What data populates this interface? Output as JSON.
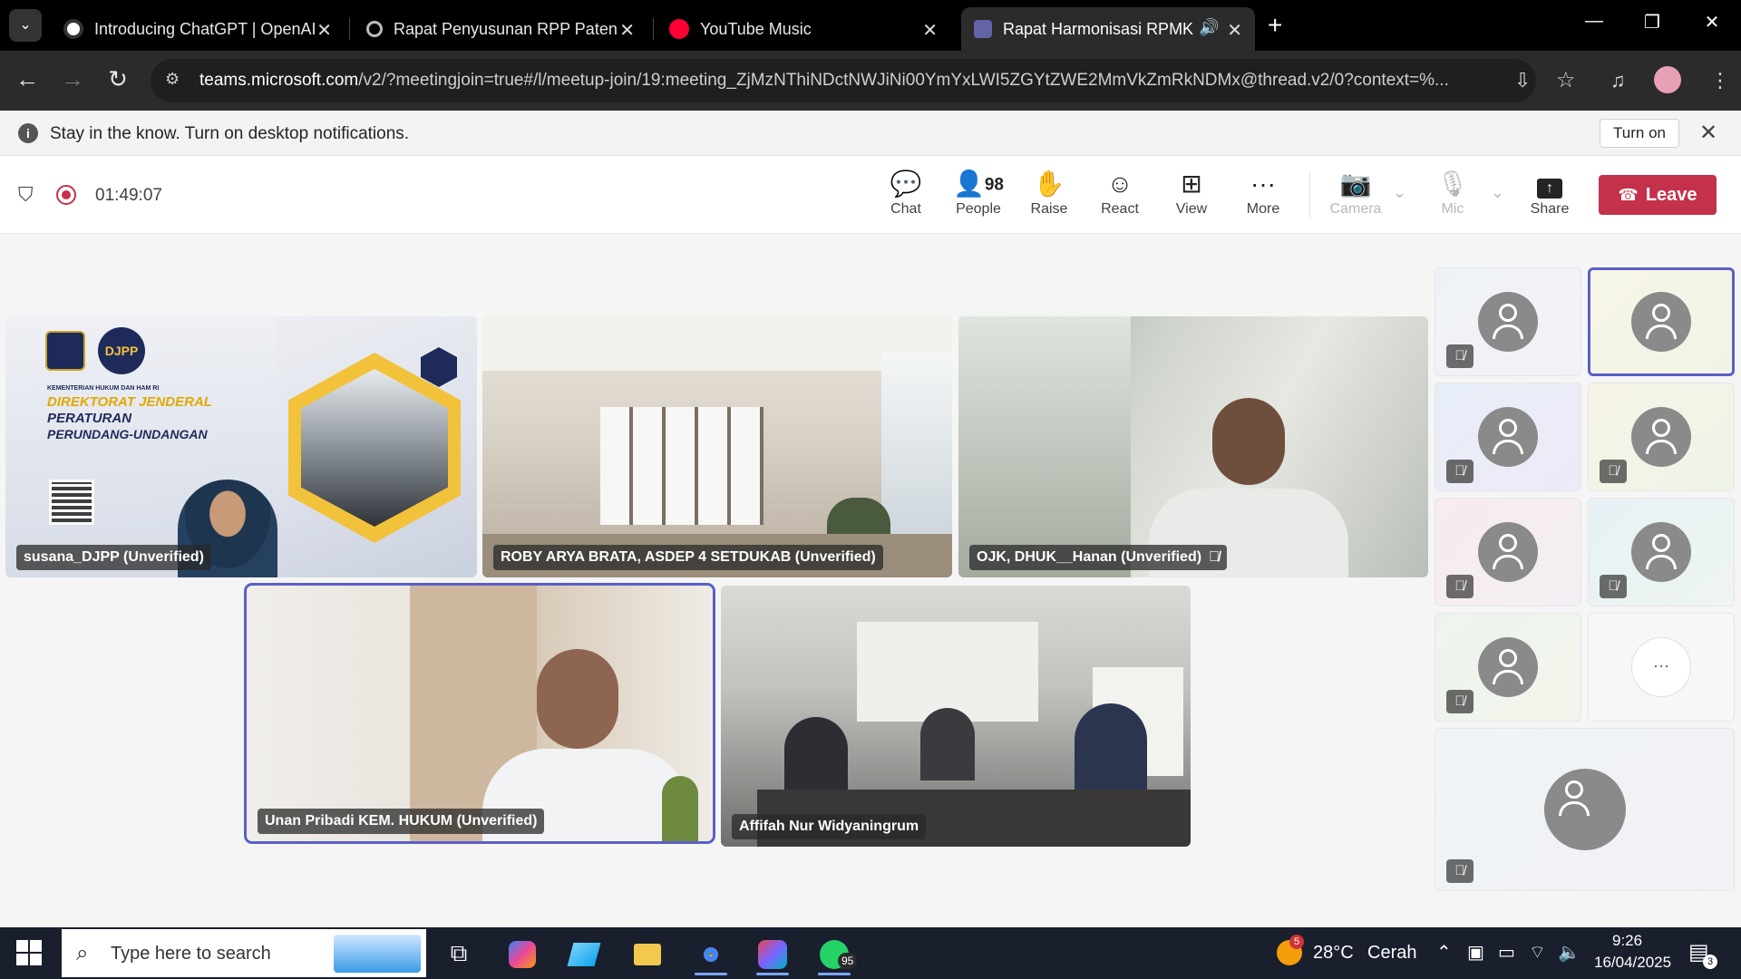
{
  "browser": {
    "tabs": [
      {
        "label": "Introducing ChatGPT | OpenAI",
        "icon": "openai-icon"
      },
      {
        "label": "Rapat Penyusunan RPP Paten",
        "icon": "openai-icon"
      },
      {
        "label": "YouTube Music",
        "icon": "youtube-music-icon"
      },
      {
        "label": "Rapat Harmonisasi RPMK Ke",
        "icon": "teams-icon"
      }
    ],
    "new_tab_symbol": "+",
    "url_domain": "teams.microsoft.com",
    "url_rest": "/v2/?meetingjoin=true#/l/meetup-join/19:meeting_ZjMzNThiNDctNWJiNi00YmYxLWI5ZGYtZWE2MmVkZmRkNDMx@thread.v2/0?context=%..."
  },
  "notification": {
    "message": "Stay in the know. Turn on desktop notifications.",
    "turn_on_label": "Turn on"
  },
  "meeting": {
    "timer": "01:49:07",
    "controls": [
      {
        "label": "Chat",
        "icon": "chat-icon"
      },
      {
        "label": "People",
        "icon": "people-icon",
        "count": "98"
      },
      {
        "label": "Raise",
        "icon": "raise-hand-icon"
      },
      {
        "label": "React",
        "icon": "react-icon"
      },
      {
        "label": "View",
        "icon": "view-icon"
      },
      {
        "label": "More",
        "icon": "more-icon"
      },
      {
        "label": "Camera",
        "icon": "camera-off-icon",
        "disabled": true
      },
      {
        "label": "Mic",
        "icon": "mic-off-icon",
        "disabled": true
      },
      {
        "label": "Share",
        "icon": "share-icon"
      }
    ],
    "leave_label": "Leave"
  },
  "video_tiles": [
    {
      "name": "susana_DJPP (Unverified)",
      "muted": false,
      "slide_lines": [
        "KEMENTERIAN HUKUM DAN HAM RI",
        "DIREKTORAT JENDERAL",
        "PERATURAN",
        "PERUNDANG-UNDANGAN"
      ],
      "logo": "DJPP"
    },
    {
      "name": "ROBY ARYA BRATA, ASDEP 4 SETDUKAB (Unverified)",
      "muted": false
    },
    {
      "name": "OJK, DHUK__Hanan (Unverified)",
      "muted": true
    },
    {
      "name": "Unan Pribadi KEM. HUKUM (Unverified)",
      "muted": false,
      "speaking": true
    },
    {
      "name": "Affifah Nur Widyaningrum",
      "muted": false
    }
  ],
  "participant_overflow": {
    "more_symbol": "···"
  },
  "taskbar": {
    "search_placeholder": "Type here to search",
    "weather_temp": "28°C",
    "weather_desc": "Cerah",
    "weather_badge": "5",
    "whatsapp_badge": "95",
    "time": "9:26",
    "date": "16/04/2025",
    "notification_count": "3"
  }
}
